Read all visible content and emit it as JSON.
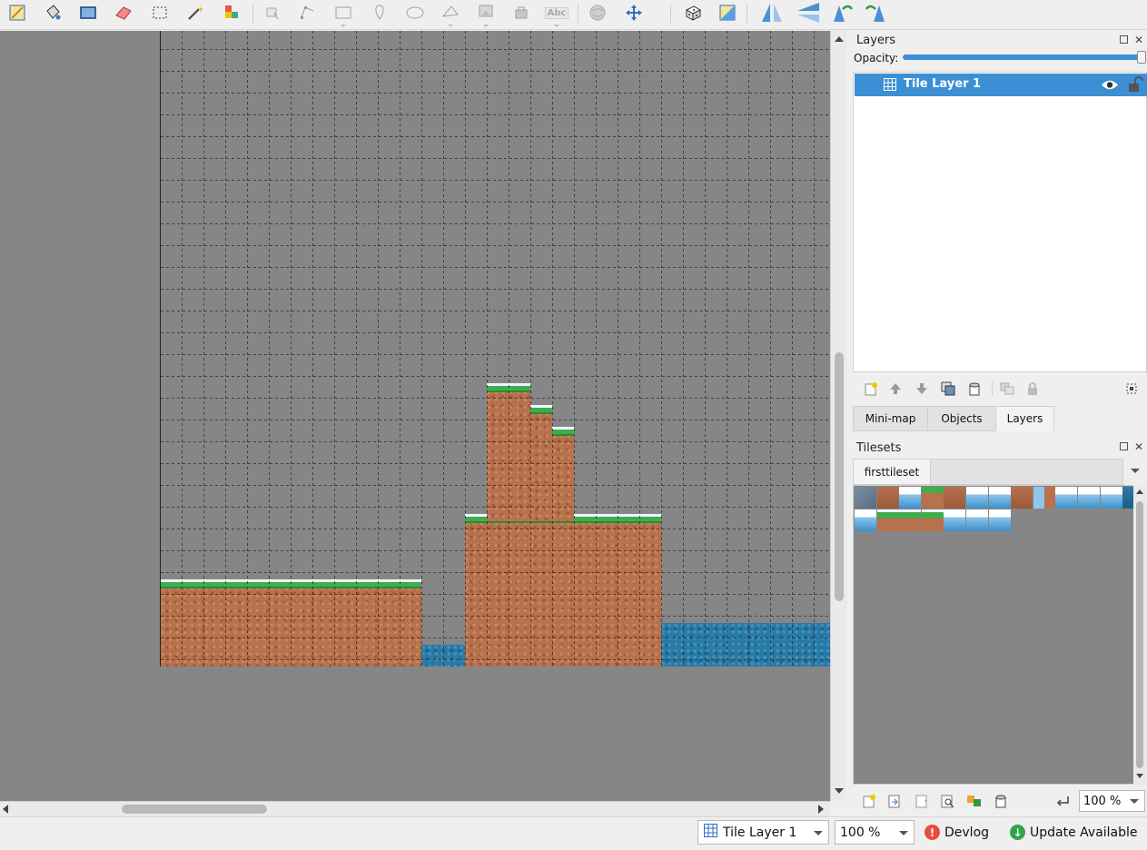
{
  "toolbar": {
    "tools": [
      {
        "name": "new-map-icon"
      },
      {
        "name": "bucket-fill-icon"
      },
      {
        "name": "shape-fill-icon"
      },
      {
        "name": "eraser-icon"
      },
      {
        "name": "rect-select-icon"
      },
      {
        "name": "magic-wand-icon"
      },
      {
        "name": "select-same-tile-icon"
      },
      {
        "name": "select-objects-icon"
      },
      {
        "name": "edit-polygons-icon"
      },
      {
        "name": "insert-rectangle-icon"
      },
      {
        "name": "insert-point-icon"
      },
      {
        "name": "insert-ellipse-icon"
      },
      {
        "name": "insert-polygon-icon"
      },
      {
        "name": "insert-tile-icon"
      },
      {
        "name": "insert-template-icon"
      },
      {
        "name": "insert-text-icon",
        "label": "Abc"
      },
      {
        "name": "world-tool-icon"
      },
      {
        "name": "move-icon"
      },
      {
        "name": "random-mode-icon"
      },
      {
        "name": "wang-fill-icon"
      },
      {
        "name": "flip-horizontal-icon"
      },
      {
        "name": "flip-vertical-icon"
      },
      {
        "name": "rotate-left-icon"
      },
      {
        "name": "rotate-right-icon"
      }
    ]
  },
  "layers_panel": {
    "title": "Layers",
    "opacity_label": "Opacity:",
    "opacity": 1.0,
    "layers": [
      {
        "name": "Tile Layer 1",
        "visible": true,
        "locked": false,
        "selected": true
      }
    ]
  },
  "dock_tabs": {
    "tabs": [
      "Mini-map",
      "Objects",
      "Layers"
    ],
    "active": "Layers"
  },
  "tilesets_panel": {
    "title": "Tilesets",
    "tabs": [
      "firsttileset"
    ],
    "active_tab": "firsttileset",
    "zoom": "100 %"
  },
  "statusbar": {
    "current_layer": "Tile Layer 1",
    "zoom": "100 %",
    "devlog_label": "Devlog",
    "update_label": "Update Available"
  },
  "colors": {
    "selection": "#3c8fd4",
    "canvas_bg": "#868686",
    "devlog_dot": "#e74c3c",
    "update_dot": "#2ea44f"
  }
}
